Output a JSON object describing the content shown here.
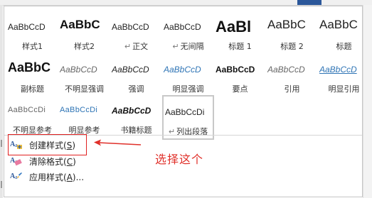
{
  "styles": [
    {
      "preview": "AaBbCcD",
      "name": "样式1",
      "para": false,
      "preview_style": "normal"
    },
    {
      "preview": "AaBbC",
      "name": "样式2",
      "para": false,
      "preview_style": "bold-large"
    },
    {
      "preview": "AaBbCcD",
      "name": "正文",
      "para": true,
      "preview_style": "normal"
    },
    {
      "preview": "AaBbCcD",
      "name": "无间隔",
      "para": true,
      "preview_style": "normal"
    },
    {
      "preview": "AaBl",
      "name": "标题 1",
      "para": false,
      "preview_style": "heading1"
    },
    {
      "preview": "AaBbC",
      "name": "标题 2",
      "para": false,
      "preview_style": "heading2"
    },
    {
      "preview": "AaBbC",
      "name": "标题",
      "para": false,
      "preview_style": "title"
    },
    {
      "preview": "AaBbC",
      "name": "副标题",
      "para": false,
      "preview_style": "subtitle"
    },
    {
      "preview": "AaBbCcD",
      "name": "不明显强调",
      "para": false,
      "preview_style": "italic-gray"
    },
    {
      "preview": "AaBbCcD",
      "name": "强调",
      "para": false,
      "preview_style": "italic"
    },
    {
      "preview": "AaBbCcD",
      "name": "明显强调",
      "para": false,
      "preview_style": "italic-blue"
    },
    {
      "preview": "AaBbCcD",
      "name": "要点",
      "para": false,
      "preview_style": "bold"
    },
    {
      "preview": "AaBbCcD",
      "name": "引用",
      "para": false,
      "preview_style": "italic-gray"
    },
    {
      "preview": "AaBbCcD",
      "name": "明显引用",
      "para": false,
      "preview_style": "italic-blue-under"
    },
    {
      "preview": "AaBbCcDi",
      "name": "不明显参考",
      "para": false,
      "preview_style": "smallcaps-gray"
    },
    {
      "preview": "AaBbCcDi",
      "name": "明显参考",
      "para": false,
      "preview_style": "smallcaps-blue"
    },
    {
      "preview": "AaBbCcD",
      "name": "书籍标题",
      "para": false,
      "preview_style": "bold-italic"
    },
    {
      "preview": "AaBbCcDi",
      "name": "列出段落",
      "para": true,
      "preview_style": "normal",
      "selected": true
    }
  ],
  "menu": {
    "create_style": {
      "label": "创建样式(",
      "key": "S",
      ")": ")"
    },
    "clear_format": {
      "label": "清除格式(",
      "key": "C",
      ")": ")"
    },
    "apply_style": {
      "label": "应用样式(",
      "key": "A",
      ")": ")..."
    }
  },
  "annotation": {
    "text": "选择这个"
  },
  "colors": {
    "annotation": "#e0302a",
    "heading_blue": "#2e74b5",
    "accent_blue": "#2b579a"
  }
}
